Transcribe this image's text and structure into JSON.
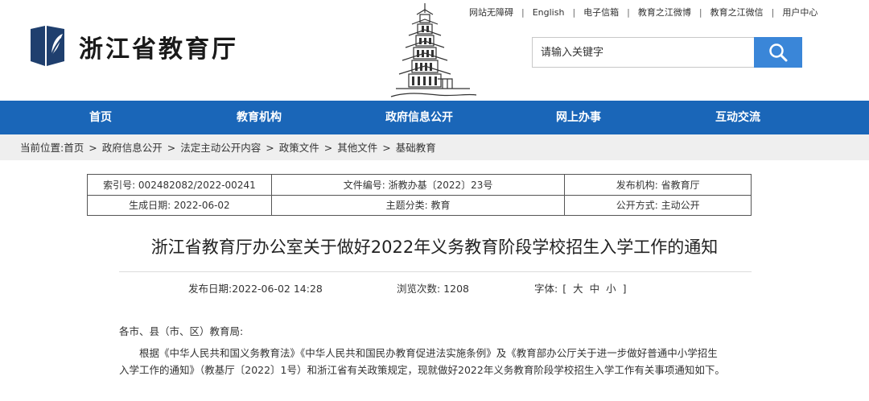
{
  "header": {
    "site_name": "浙江省教育厅",
    "toplinks": [
      "网站无障碍",
      "English",
      "电子信箱",
      "教育之江微博",
      "教育之江微信",
      "用户中心"
    ],
    "search": {
      "placeholder": "请输入关键字"
    }
  },
  "nav": [
    "首页",
    "教育机构",
    "政府信息公开",
    "网上办事",
    "互动交流"
  ],
  "breadcrumb": {
    "prefix": "当前位置:",
    "items": [
      "首页",
      "政府信息公开",
      "法定主动公开内容",
      "政策文件",
      "其他文件",
      "基础教育"
    ]
  },
  "info": {
    "index_no": "索引号: 002482082/2022-00241",
    "doc_no": "文件编号: 浙教办基〔2022〕23号",
    "publisher": "发布机构: 省教育厅",
    "date": "生成日期: 2022-06-02",
    "category": "主题分类: 教育",
    "mode": "公开方式: 主动公开"
  },
  "article": {
    "title": "浙江省教育厅办公室关于做好2022年义务教育阶段学校招生入学工作的通知",
    "published": "发布日期:2022-06-02 14:28",
    "views": "浏览次数: 1208",
    "font_label": "字体:",
    "font_sizes": [
      "[",
      "大",
      "中",
      "小",
      "]"
    ],
    "greeting": "各市、县（市、区）教育局:",
    "para1": "根据《中华人民共和国义务教育法》《中华人民共和国民办教育促进法实施条例》及《教育部办公厅关于进一步做好普通中小学招生入学工作的通知》（教基厅〔2022〕1号）和浙江省有关政策规定，现就做好2022年义务教育阶段学校招生入学工作有关事项通知如下。"
  },
  "colors": {
    "nav_bg": "#1a66b8",
    "search_btn": "#3a86d8",
    "crumb_bg": "#efefef"
  }
}
